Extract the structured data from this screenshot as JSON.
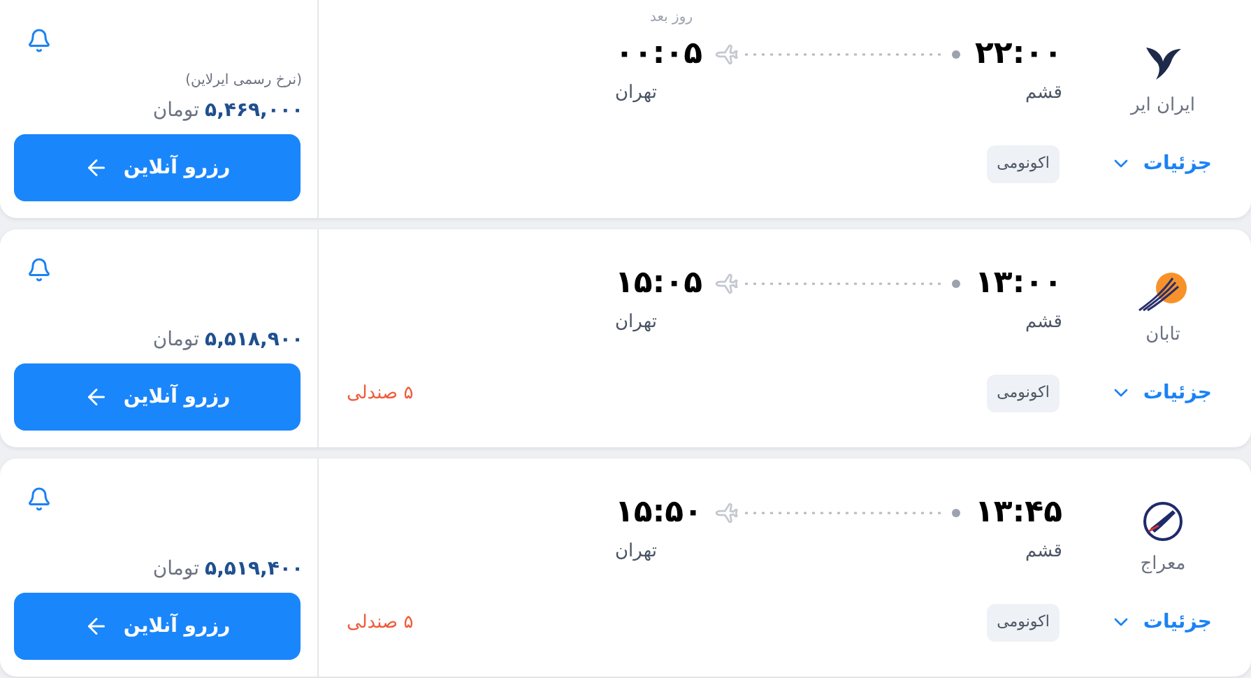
{
  "flights": [
    {
      "airline": {
        "name": "ایران ایر",
        "logo": {
          "kind": "bird"
        }
      },
      "departure": {
        "time": "۲۲:۰۰",
        "city": "قشم"
      },
      "arrival": {
        "time": "۰۰:۰۵",
        "city": "تهران",
        "note": "روز بعد"
      },
      "cabin": "اکونومی",
      "details_label": "جزئیات",
      "price": {
        "note": "(نرخ رسمی ایرلاین)",
        "amount": "۵,۴۶۹,۰۰۰",
        "currency": "تومان"
      },
      "book_label": "رزرو آنلاین"
    },
    {
      "airline": {
        "name": "تابان",
        "logo": {
          "kind": "sun"
        }
      },
      "departure": {
        "time": "۱۳:۰۰",
        "city": "قشم"
      },
      "arrival": {
        "time": "۱۵:۰۵",
        "city": "تهران"
      },
      "cabin": "اکونومی",
      "details_label": "جزئیات",
      "seats": "۵ صندلی",
      "price": {
        "amount": "۵,۵۱۸,۹۰۰",
        "currency": "تومان"
      },
      "book_label": "رزرو آنلاین"
    },
    {
      "airline": {
        "name": "معراج",
        "logo": {
          "kind": "ring"
        }
      },
      "departure": {
        "time": "۱۳:۴۵",
        "city": "قشم"
      },
      "arrival": {
        "time": "۱۵:۵۰",
        "city": "تهران"
      },
      "cabin": "اکونومی",
      "details_label": "جزئیات",
      "seats": "۵ صندلی",
      "price": {
        "amount": "۵,۵۱۹,۴۰۰",
        "currency": "تومان"
      },
      "book_label": "رزرو آنلاین"
    }
  ]
}
